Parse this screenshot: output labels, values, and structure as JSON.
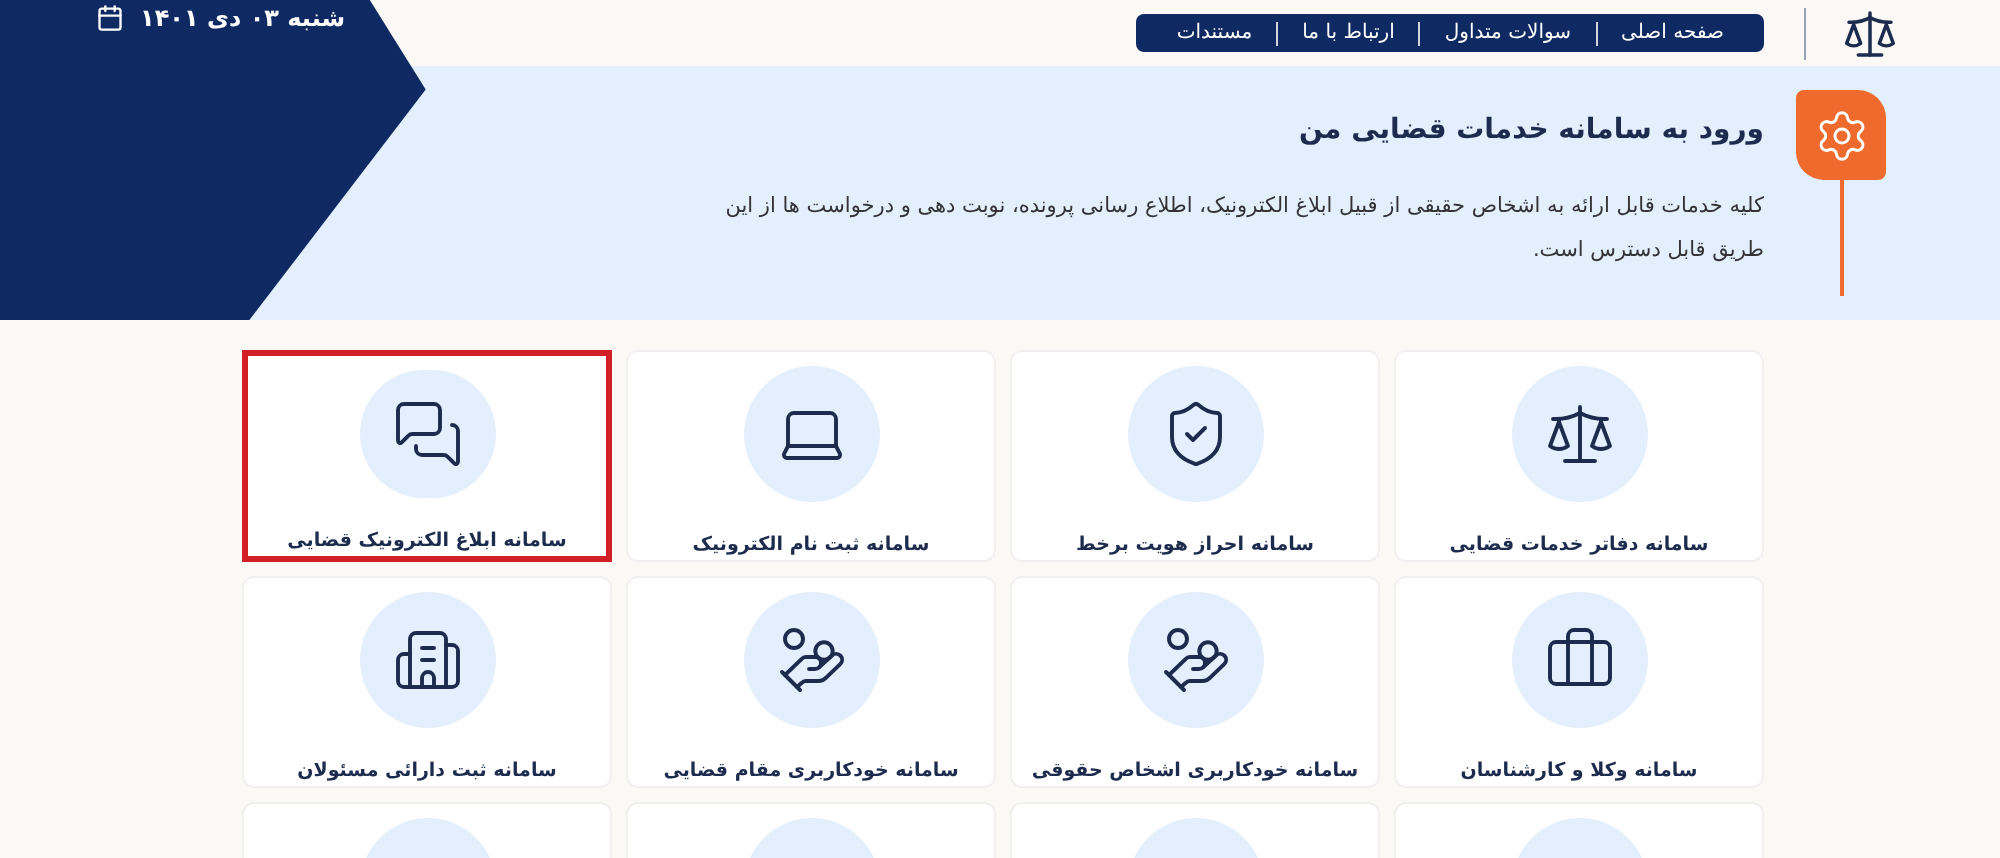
{
  "header": {
    "date": "شنبه ۰۳ دی ۱۴۰۱",
    "nav": [
      {
        "label": "صفحه اصلی"
      },
      {
        "label": "سوالات متداول"
      },
      {
        "label": "ارتباط با ما"
      },
      {
        "label": "مستندات"
      }
    ]
  },
  "intro": {
    "title": "ورود به سامانه خدمات قضایی من",
    "text": "کلیه خدمات قابل ارائه به اشخاص حقیقی از قبیل ابلاغ الکترونیک، اطلاع رسانی پرونده، نوبت دهی و درخواست ها از این طریق قابل دسترس است."
  },
  "cards": [
    {
      "title": "سامانه دفاتر خدمات قضایی",
      "selected": false
    },
    {
      "title": "سامانه احراز هویت برخط",
      "selected": false
    },
    {
      "title": "سامانه ثبت نام الکترونیک",
      "selected": false
    },
    {
      "title": "سامانه ابلاغ الکترونیک قضایی",
      "selected": true
    },
    {
      "title": "سامانه وکلا و کارشناسان",
      "selected": false
    },
    {
      "title": "سامانه خودکاربری اشخاص حقوقی",
      "selected": false
    },
    {
      "title": "سامانه خودکاربری مقام قضایی",
      "selected": false
    },
    {
      "title": "سامانه ثبت دارائی مسئولان",
      "selected": false
    }
  ]
}
